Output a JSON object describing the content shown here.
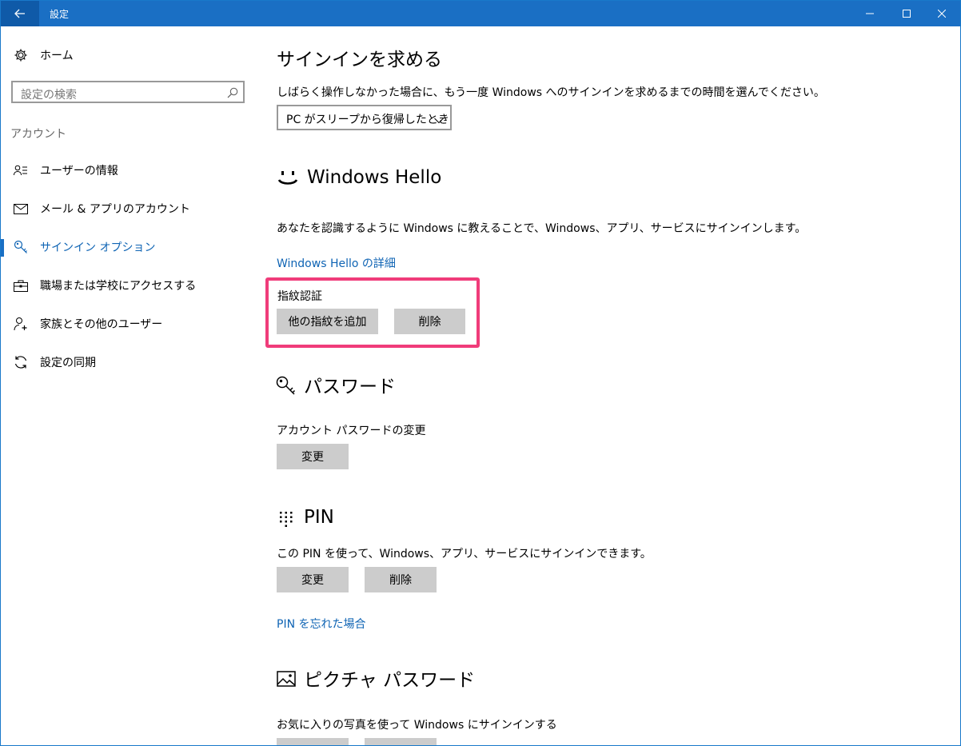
{
  "window": {
    "title": "設定"
  },
  "sidebar": {
    "home_label": "ホーム",
    "search_placeholder": "設定の検索",
    "section_label": "アカウント",
    "items": [
      {
        "label": "ユーザーの情報",
        "icon": "user-info-icon"
      },
      {
        "label": "メール & アプリのアカウント",
        "icon": "mail-icon"
      },
      {
        "label": "サインイン オプション",
        "icon": "key-icon",
        "active": true
      },
      {
        "label": "職場または学校にアクセスする",
        "icon": "briefcase-icon"
      },
      {
        "label": "家族とその他のユーザー",
        "icon": "add-person-icon"
      },
      {
        "label": "設定の同期",
        "icon": "sync-icon"
      }
    ]
  },
  "signin_required": {
    "heading": "サインインを求める",
    "description": "しばらく操作しなかった場合に、もう一度 Windows へのサインインを求めるまでの時間を選んでください。",
    "dropdown_value": "PC がスリープから復帰したとき"
  },
  "hello": {
    "heading": "Windows Hello",
    "description": "あなたを認識するように Windows に教えることで、Windows、アプリ、サービスにサインインします。",
    "link": "Windows Hello の詳細",
    "fingerprint_label": "指紋認証",
    "add_button": "他の指紋を追加",
    "remove_button": "削除"
  },
  "password": {
    "heading": "パスワード",
    "label": "アカウント パスワードの変更",
    "change_button": "変更"
  },
  "pin": {
    "heading": "PIN",
    "description": "この PIN を使って、Windows、アプリ、サービスにサインインできます。",
    "change_button": "変更",
    "remove_button": "削除",
    "forgot_link": "PIN を忘れた場合"
  },
  "picture_password": {
    "heading": "ピクチャ パスワード",
    "description": "お気に入りの写真を使って Windows にサインインする"
  },
  "colors": {
    "titlebar": "#1a6fc4",
    "accent": "#0f64b4",
    "highlight": "#f03c7a",
    "button": "#cccccc"
  }
}
